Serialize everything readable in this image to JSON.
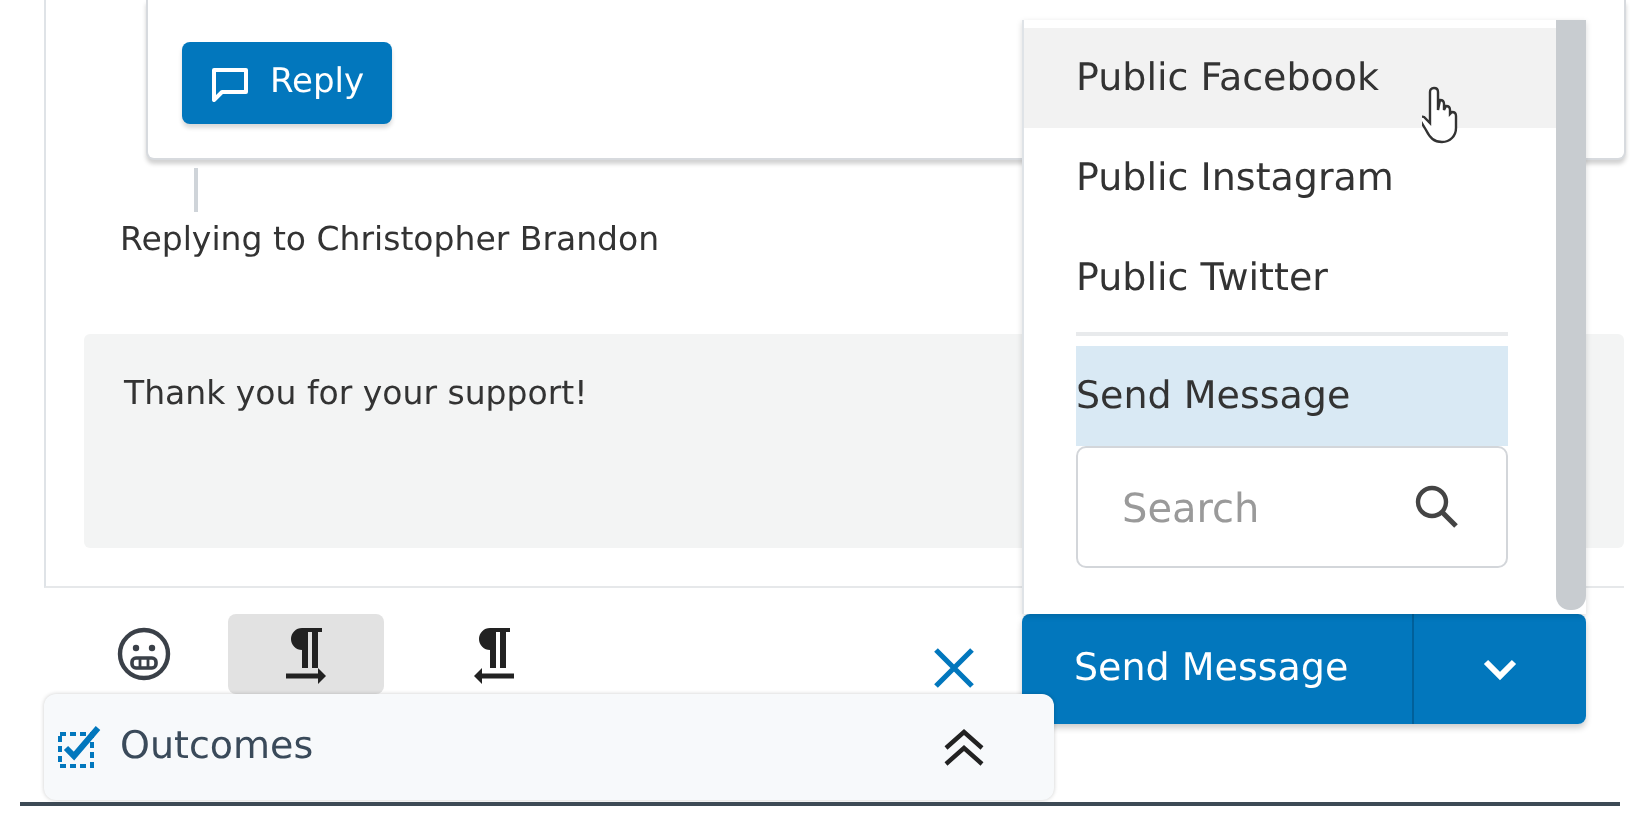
{
  "reply_button": {
    "label": "Reply"
  },
  "replying_to": "Replying to Christopher Brandon",
  "message": {
    "value": "Thank you for your support!"
  },
  "toolbar": {
    "buttons": [
      {
        "kind": "emoji",
        "selected": false
      },
      {
        "kind": "ltr",
        "selected": true
      },
      {
        "kind": "rtl",
        "selected": false
      }
    ]
  },
  "send_button": {
    "label": "Send Message"
  },
  "channel_menu": {
    "groups": [
      [
        {
          "label": "Public Facebook",
          "hovered": true,
          "selected": false
        },
        {
          "label": "Public Instagram",
          "hovered": false,
          "selected": false
        },
        {
          "label": "Public Twitter",
          "hovered": false,
          "selected": false
        }
      ],
      [
        {
          "label": "Send Message",
          "hovered": false,
          "selected": true
        }
      ]
    ],
    "search": {
      "placeholder": "Search"
    }
  },
  "outcomes": {
    "label": "Outcomes"
  }
}
